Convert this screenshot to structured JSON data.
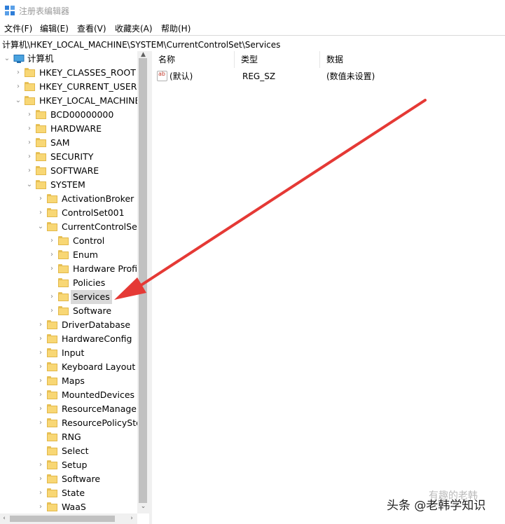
{
  "window": {
    "title": "注册表编辑器"
  },
  "menu": [
    "文件(F)",
    "编辑(E)",
    "查看(V)",
    "收藏夹(A)",
    "帮助(H)"
  ],
  "address": "计算机\\HKEY_LOCAL_MACHINE\\SYSTEM\\CurrentControlSet\\Services",
  "tree": {
    "root": "计算机",
    "items": [
      {
        "label": "HKEY_CLASSES_ROOT",
        "level": 1,
        "expanded": false
      },
      {
        "label": "HKEY_CURRENT_USER",
        "level": 1,
        "expanded": false
      },
      {
        "label": "HKEY_LOCAL_MACHINE",
        "level": 1,
        "expanded": true
      },
      {
        "label": "BCD00000000",
        "level": 2,
        "expanded": false
      },
      {
        "label": "HARDWARE",
        "level": 2,
        "expanded": false
      },
      {
        "label": "SAM",
        "level": 2,
        "expanded": false
      },
      {
        "label": "SECURITY",
        "level": 2,
        "expanded": false
      },
      {
        "label": "SOFTWARE",
        "level": 2,
        "expanded": false
      },
      {
        "label": "SYSTEM",
        "level": 2,
        "expanded": true
      },
      {
        "label": "ActivationBroker",
        "level": 3,
        "expanded": false
      },
      {
        "label": "ControlSet001",
        "level": 3,
        "expanded": false
      },
      {
        "label": "CurrentControlSet",
        "level": 3,
        "expanded": true
      },
      {
        "label": "Control",
        "level": 4,
        "expanded": false
      },
      {
        "label": "Enum",
        "level": 4,
        "expanded": false
      },
      {
        "label": "Hardware Profil",
        "level": 4,
        "expanded": false
      },
      {
        "label": "Policies",
        "level": 4,
        "leaf": true
      },
      {
        "label": "Services",
        "level": 4,
        "expanded": false,
        "selected": true
      },
      {
        "label": "Software",
        "level": 4,
        "expanded": false
      },
      {
        "label": "DriverDatabase",
        "level": 3,
        "expanded": false
      },
      {
        "label": "HardwareConfig",
        "level": 3,
        "expanded": false
      },
      {
        "label": "Input",
        "level": 3,
        "expanded": false
      },
      {
        "label": "Keyboard Layout",
        "level": 3,
        "expanded": false
      },
      {
        "label": "Maps",
        "level": 3,
        "expanded": false
      },
      {
        "label": "MountedDevices",
        "level": 3,
        "expanded": false
      },
      {
        "label": "ResourceManager",
        "level": 3,
        "expanded": false
      },
      {
        "label": "ResourcePolicySto",
        "level": 3,
        "expanded": false
      },
      {
        "label": "RNG",
        "level": 3,
        "leaf": true
      },
      {
        "label": "Select",
        "level": 3,
        "leaf": true
      },
      {
        "label": "Setup",
        "level": 3,
        "expanded": false
      },
      {
        "label": "Software",
        "level": 3,
        "expanded": false
      },
      {
        "label": "State",
        "level": 3,
        "expanded": false
      },
      {
        "label": "WaaS",
        "level": 3,
        "expanded": false
      }
    ]
  },
  "list": {
    "columns": [
      "名称",
      "类型",
      "数据"
    ],
    "rows": [
      {
        "name": "(默认)",
        "type": "REG_SZ",
        "data": "(数值未设置)"
      }
    ]
  },
  "watermark": {
    "main": "头条 @老韩学知识",
    "faint": "有趣的老韩"
  },
  "colors": {
    "arrow": "#e53935",
    "folder": "#f8d775",
    "selection": "#d9d9d9"
  }
}
